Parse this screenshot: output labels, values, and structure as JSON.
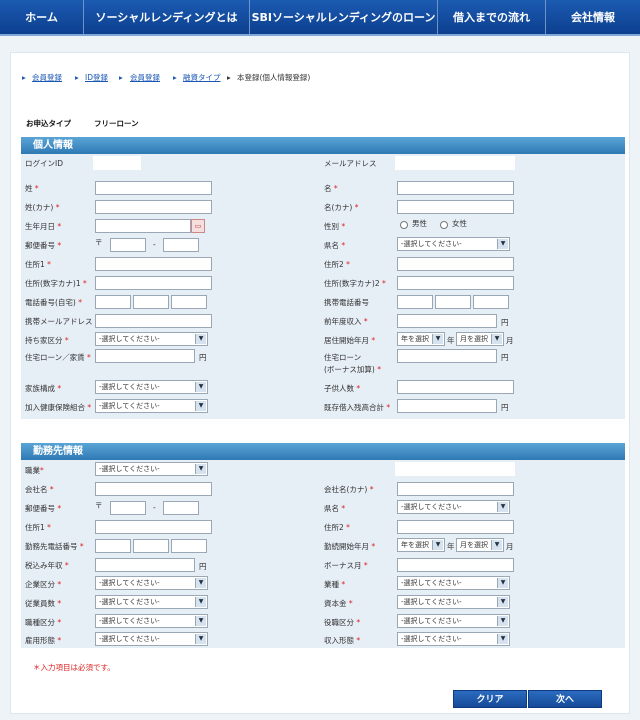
{
  "nav": [
    "ホーム",
    "ソーシャルレンディングとは",
    "SBIソーシャルレンディングのローン",
    "借入までの流れ",
    "会社情報"
  ],
  "breadcrumb": [
    "会員登録",
    "ID登録",
    "会員登録",
    "融資タイプ"
  ],
  "breadcrumb_current": "本登録(個人情報登録)",
  "loan_type_label": "お申込タイプ",
  "loan_type_value": "フリーローン",
  "personal_title": "個人情報",
  "login_id": "ログインID",
  "mail": "メールアドレス",
  "sei": "姓",
  "mei": "名",
  "sei_kana": "姓(カナ)",
  "mei_kana": "名(カナ)",
  "birth": "生年月日",
  "gender": "性別",
  "male": "男性",
  "female": "女性",
  "zip": "郵便番号",
  "zip_mark": "〒",
  "dash": "-",
  "pref": "県名",
  "addr1": "住所1",
  "addr2": "住所2",
  "addr1_kana": "住所(数字カナ)1",
  "addr2_kana": "住所(数字カナ)2",
  "home_tel": "電話番号(自宅)",
  "mobile_tel": "携帯電話番号",
  "mobile_mail": "携帯メールアドレス",
  "prev_income": "前年度収入",
  "yen": "円",
  "own_house": "持ち家区分",
  "move_ym": "居住開始年月",
  "year_sel": "年を選択",
  "month_sel": "月を選択",
  "nen": "年",
  "tsuki": "月",
  "loan_rent": "住宅ローン／家賃",
  "house_loan": "住宅ローン",
  "bonus_add": "(ボーナス加算)",
  "family": "家族構成",
  "children": "子供人数",
  "insurance": "加入健康保険組合",
  "existing_debt": "既存借入残高合計",
  "select_placeholder": "-選択してください-",
  "work_title": "勤務先情報",
  "job": "職業",
  "company": "会社名",
  "company_kana": "会社名(カナ)",
  "work_tel": "勤務先電話番号",
  "work_start": "勤続開始年月",
  "tax_income": "税込み年収",
  "bonus_month": "ボーナス月",
  "company_type": "企業区分",
  "industry": "業種",
  "employees": "従業員数",
  "capital": "資本金",
  "job_type": "職種区分",
  "position": "役職区分",
  "employment": "雇用形態",
  "income_form": "収入形態",
  "required_note": "＊入力項目は必須です。",
  "clear_btn": "クリア",
  "next_btn": "次へ"
}
